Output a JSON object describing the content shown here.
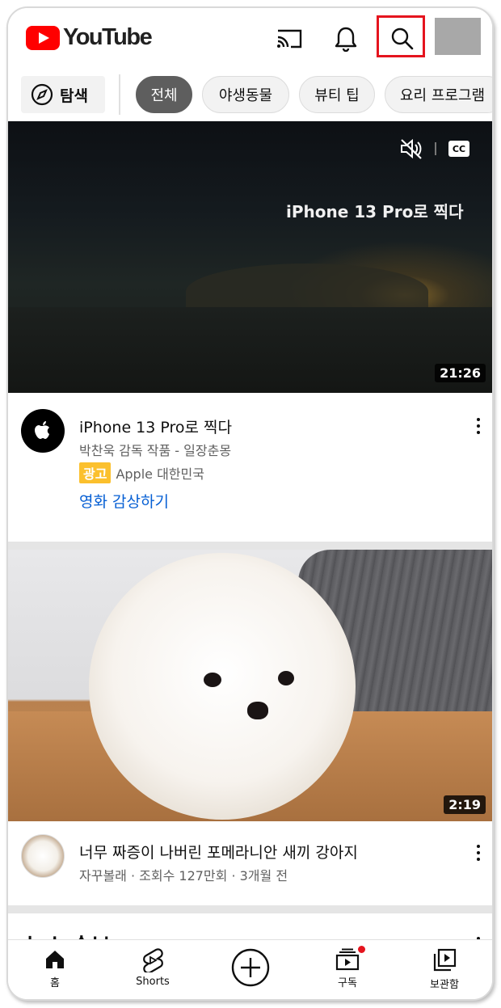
{
  "header": {
    "logo_text": "YouTube",
    "icons": [
      "cast-icon",
      "bell-icon",
      "search-icon",
      "avatar"
    ]
  },
  "chips": {
    "explore_label": "탐색",
    "items": [
      {
        "label": "전체",
        "active": true
      },
      {
        "label": "야생동물",
        "active": false
      },
      {
        "label": "뷰티 팁",
        "active": false
      },
      {
        "label": "요리 프로그램",
        "active": false
      }
    ]
  },
  "video1": {
    "overlay_title": "iPhone 13 Pro로 찍다",
    "duration": "21:26",
    "title": "iPhone 13 Pro로 찍다",
    "subtitle": "박찬욱 감독 작품 - 일장춘몽",
    "ad_label": "광고",
    "advertiser": "Apple 대한민국",
    "cta": "영화 감상하기",
    "cc_label": "CC"
  },
  "video2": {
    "duration": "2:19",
    "title": "너무 짜증이 나버린 포메라니안 새끼 강아지",
    "subtitle": "자꾸볼래 · 조회수 127만회 · 3개월 전"
  },
  "section": {
    "partial_heading": "뉴스 속보"
  },
  "bottom_nav": [
    {
      "label": "홈",
      "icon": "home-icon"
    },
    {
      "label": "Shorts",
      "icon": "shorts-icon"
    },
    {
      "label": "",
      "icon": "create-icon"
    },
    {
      "label": "구독",
      "icon": "subscriptions-icon"
    },
    {
      "label": "보관함",
      "icon": "library-icon"
    }
  ],
  "colors": {
    "brand_red": "#ff0000",
    "highlight_border": "#e5141e",
    "link_blue": "#065fd4",
    "ad_yellow": "#fbc02d"
  }
}
